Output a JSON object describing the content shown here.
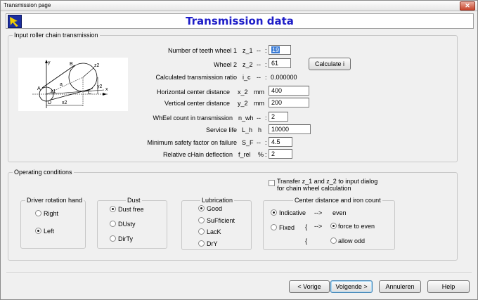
{
  "window": {
    "title": "Transmission page",
    "close_label": "✕"
  },
  "header": {
    "title": "Transmission data"
  },
  "input_group": {
    "legend": "Input roller chain transmission",
    "diagram_labels": {
      "y": "y",
      "B": "B",
      "z2": "z2",
      "A": "A",
      "a": "a",
      "z1": "z1",
      "C": "C",
      "x": "x",
      "y2": "y2",
      "D": "D",
      "x2": "x2"
    },
    "fields": {
      "teeth_wheel1": {
        "label": "Number of teeth wheel 1",
        "symbol": "z_1",
        "unit": "--",
        "value": "19"
      },
      "wheel2": {
        "label": "Wheel 2",
        "symbol": "z_2",
        "unit": "--",
        "value": "61"
      },
      "ratio": {
        "label": "Calculated transmission ratio",
        "symbol": "i_c",
        "unit": "--",
        "value": "0.000000"
      },
      "horiz": {
        "label": "Horizontal center distance",
        "symbol": "x_2",
        "unit": "mm",
        "value": "400"
      },
      "vert": {
        "label": "Vertical center distance",
        "symbol": "y_2",
        "unit": "mm",
        "value": "200"
      },
      "wheel_count": {
        "label": "WhEel count in transmission",
        "symbol": "n_wh",
        "unit": "--",
        "value": "2"
      },
      "service_life": {
        "label": "Service life",
        "symbol": "L_h",
        "unit": "h",
        "value": "10000"
      },
      "safety": {
        "label": "Minimum safety factor on failure",
        "symbol": "S_F",
        "unit": "--",
        "value": "4.5"
      },
      "deflection": {
        "label": "Relative cHain deflection",
        "symbol": "f_rel",
        "unit": "%",
        "value": "2"
      }
    },
    "calc_button": "Calculate i"
  },
  "operating": {
    "legend": "Operating conditions",
    "transfer_line1": "Transfer z_1 and z_2 to input dialog",
    "transfer_line2": "for chain wheel  calculation",
    "driver": {
      "legend": "Driver rotation hand",
      "options": [
        "Right",
        "Left"
      ],
      "selected": "Left"
    },
    "dust": {
      "legend": "Dust",
      "options": [
        "Dust free",
        "DUsty",
        "DirTy"
      ],
      "selected": "Dust free"
    },
    "lubrication": {
      "legend": "Lubrication",
      "options": [
        "Good",
        "SuFficient",
        "LacK",
        "DrY"
      ],
      "selected": "Good"
    },
    "center": {
      "legend": "Center distance   and  iron count",
      "indicative": "Indicative",
      "fixed": "Fixed",
      "arrow1": "-->",
      "arrow2": "-->",
      "brace1": "{",
      "brace2": "{",
      "even": "even",
      "force_even": "force to even",
      "allow_odd": "allow odd"
    }
  },
  "footer": {
    "prev": "< Vorige",
    "next": "Volgende >",
    "cancel": "Annuleren",
    "help": "Help"
  }
}
